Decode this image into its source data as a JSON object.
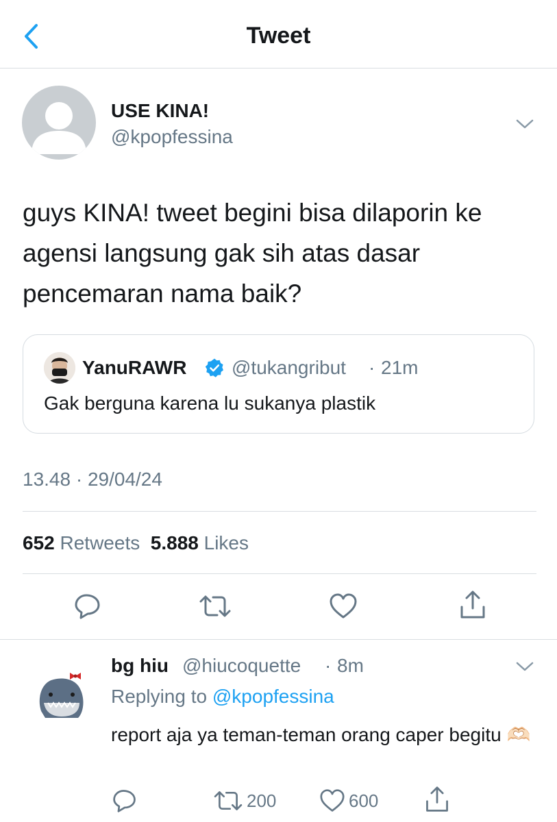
{
  "header": {
    "title": "Tweet"
  },
  "tweet": {
    "display_name": "USE KINA!",
    "handle": "@kpopfessina",
    "text": "guys KINA! tweet begini bisa dilaporin ke agensi langsung gak sih atas dasar pencemaran nama baik?",
    "timestamp": "13.48 · 29/04/24",
    "retweets_count": "652",
    "retweets_label": "Retweets",
    "likes_count": "5.888",
    "likes_label": "Likes"
  },
  "quote": {
    "display_name": "YanuRAWR",
    "handle": "@tukangribut",
    "separator": "·",
    "time": "21m",
    "text": "Gak berguna karena lu sukanya plastik",
    "verified": true
  },
  "reply": {
    "display_name": "bg hiu",
    "handle": "@hiucoquette",
    "separator": "·",
    "time": "8m",
    "replying_prefix": "Replying to",
    "replying_mention": "@kpopfessina",
    "text": "report aja ya teman-teman orang caper begitu 🫶🏻",
    "retweets_count": "200",
    "likes_count": "600"
  },
  "icons": {
    "back": "chevron-left-icon",
    "caret": "chevron-down-icon",
    "reply": "comment-icon",
    "retweet": "retweet-icon",
    "like": "heart-icon",
    "share": "share-icon",
    "verified": "verified-badge-icon"
  },
  "colors": {
    "accent": "#1da1f2",
    "secondary_text": "#657786",
    "divider": "#d8dde1"
  }
}
